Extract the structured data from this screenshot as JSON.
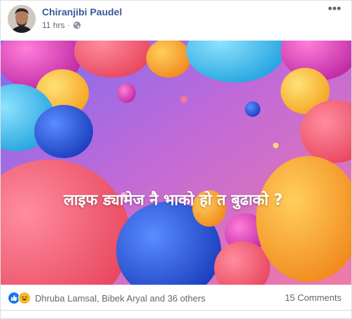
{
  "post": {
    "author": "Chiranjibi Paudel",
    "time": "11 hrs",
    "separator": "·",
    "privacy_icon": "globe-icon",
    "more_label": "•••",
    "image_caption": "लाइफ ड्यामेज नै भाको हो त बुढाको ?",
    "reactions": {
      "icons": [
        "like-icon",
        "haha-icon"
      ],
      "summary": "Dhruba Lamsal, Bibek Aryal and 36 others"
    },
    "comments_count": "15 Comments"
  },
  "colors": {
    "link": "#385898",
    "meta": "#616770",
    "like": "#1877f2",
    "haha": "#f7b928"
  }
}
